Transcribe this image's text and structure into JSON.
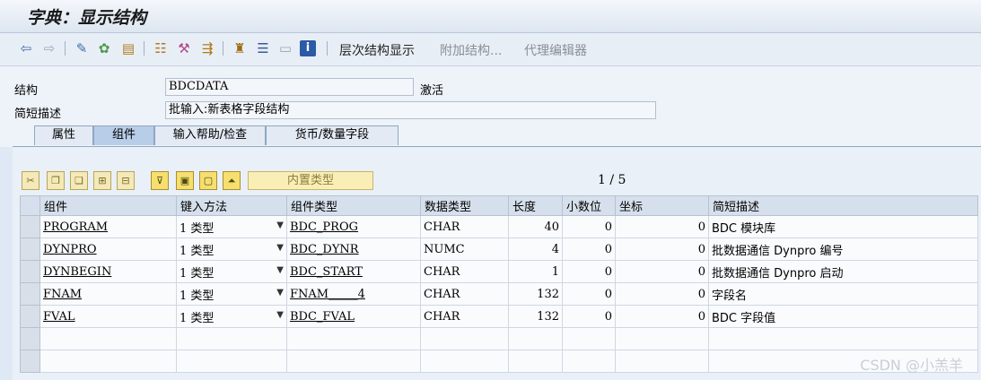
{
  "window": {
    "title": "字典：显示结构"
  },
  "toolbar": {
    "hierarchy_display": "层次结构显示",
    "append_structure": "附加结构...",
    "proxy_editor": "代理编辑器"
  },
  "form": {
    "structure_label": "结构",
    "structure_value": "BDCDATA",
    "status": "激活",
    "short_desc_label": "简短描述",
    "short_desc_value": "批输入:新表格字段结构"
  },
  "tabs": [
    {
      "label": "属性"
    },
    {
      "label": "组件"
    },
    {
      "label": "输入帮助/检查"
    },
    {
      "label": "货币/数量字段"
    }
  ],
  "grid_toolbar": {
    "builtin_type": "内置类型",
    "pager": "1  /  5"
  },
  "table": {
    "headers": [
      "组件",
      "键入方法",
      "组件类型",
      "数据类型",
      "长度",
      "小数位",
      "坐标",
      "简短描述"
    ],
    "rows": [
      {
        "component": "PROGRAM",
        "typing": "1 类型",
        "comp_type": "BDC_PROG",
        "data_type": "CHAR",
        "length": "40",
        "decimals": "0",
        "coord": "0",
        "desc": "BDC 模块库"
      },
      {
        "component": "DYNPRO",
        "typing": "1 类型",
        "comp_type": "BDC_DYNR",
        "data_type": "NUMC",
        "length": "4",
        "decimals": "0",
        "coord": "0",
        "desc": "批数据通信 Dynpro 编号"
      },
      {
        "component": "DYNBEGIN",
        "typing": "1 类型",
        "comp_type": "BDC_START",
        "data_type": "CHAR",
        "length": "1",
        "decimals": "0",
        "coord": "0",
        "desc": "批数据通信 Dynpro 启动"
      },
      {
        "component": "FNAM",
        "typing": "1 类型",
        "comp_type": "FNAM_____4",
        "data_type": "CHAR",
        "length": "132",
        "decimals": "0",
        "coord": "0",
        "desc": "字段名"
      },
      {
        "component": "FVAL",
        "typing": "1 类型",
        "comp_type": "BDC_FVAL",
        "data_type": "CHAR",
        "length": "132",
        "decimals": "0",
        "coord": "0",
        "desc": "BDC 字段值"
      }
    ]
  },
  "watermark": "CSDN @小羔羊"
}
